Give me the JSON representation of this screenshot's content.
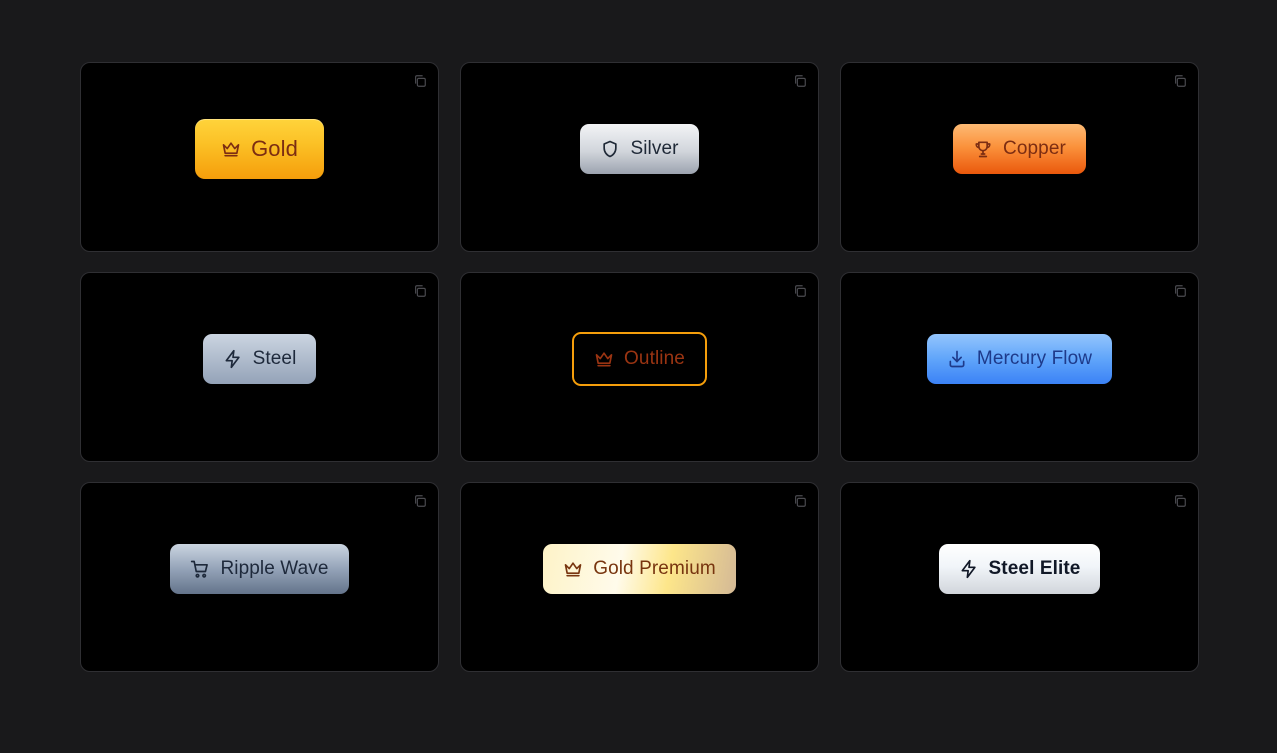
{
  "cards": [
    {
      "label": "Gold",
      "icon": "crown-icon",
      "copy_icon": "copy-icon"
    },
    {
      "label": "Silver",
      "icon": "shield-icon",
      "copy_icon": "copy-icon"
    },
    {
      "label": "Copper",
      "icon": "trophy-icon",
      "copy_icon": "copy-icon"
    },
    {
      "label": "Steel",
      "icon": "lightning-icon",
      "copy_icon": "copy-icon"
    },
    {
      "label": "Outline",
      "icon": "crown-icon",
      "copy_icon": "copy-icon"
    },
    {
      "label": "Mercury Flow",
      "icon": "download-icon",
      "copy_icon": "copy-icon"
    },
    {
      "label": "Ripple Wave",
      "icon": "cart-icon",
      "copy_icon": "copy-icon"
    },
    {
      "label": "Gold Premium",
      "icon": "crown-icon",
      "copy_icon": "copy-icon"
    },
    {
      "label": "Steel Elite",
      "icon": "lightning-icon",
      "copy_icon": "copy-icon"
    }
  ],
  "colors": {
    "page_background": "#19191b",
    "card_background": "#000000",
    "card_border": "#2f2f33",
    "gold": "#fbbf24",
    "silver": "#d1d5db",
    "copper": "#fb923c",
    "steel": "#94a3b8",
    "outline_border": "#f59e0b",
    "mercury": "#60a5fa",
    "gold_premium": "#fef3c7",
    "steel_elite": "#f1f5f9"
  }
}
